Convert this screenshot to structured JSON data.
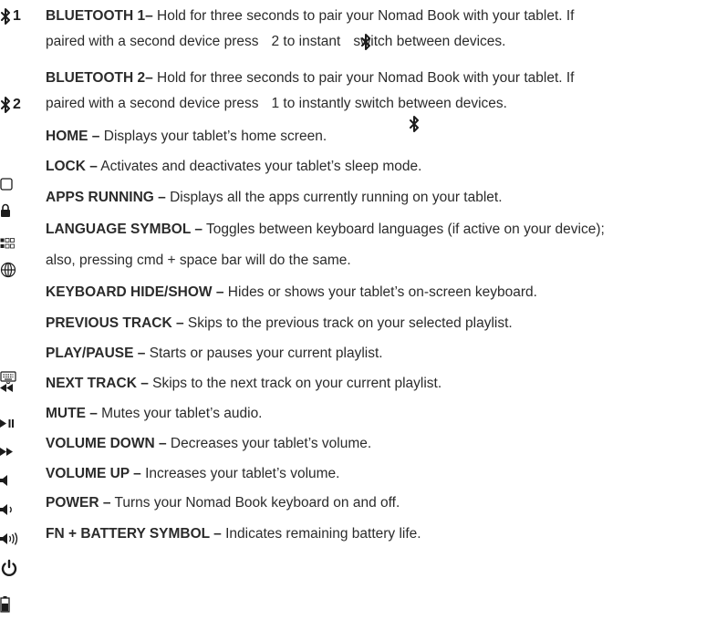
{
  "entries": [
    {
      "key": "BLUETOOTH 1–",
      "text": " Hold for three seconds to pair your Nomad Book with your tablet. If"
    },
    {
      "key": "",
      "text": "paired with a second device press"
    },
    {
      "key": "",
      "text": "2 to instant"
    },
    {
      "key": "",
      "text": "switch between devices."
    },
    {
      "key": "BLUETOOTH 2–",
      "text": " Hold for three seconds to pair your Nomad Book with your tablet. If"
    },
    {
      "key": "",
      "text": "paired with a second device press"
    },
    {
      "key": "",
      "text": "1 to instantly switch between devices."
    },
    {
      "key": "HOME –",
      "text": " Displays your tablet’s home screen."
    },
    {
      "key": "LOCK –",
      "text": " Activates and deactivates your tablet’s sleep mode."
    },
    {
      "key": "APPS RUNNING  –",
      "text": " Displays all the apps currently running on your tablet."
    },
    {
      "key": "LANGUAGE SYMBOL –",
      "text": "  Toggles between keyboard languages (if active on your device);"
    },
    {
      "key": "",
      "text": "also, pressing cmd + space bar will do the same."
    },
    {
      "key": "KEYBOARD HIDE/SHOW –",
      "text": " Hides or shows your tablet’s on-screen keyboard."
    },
    {
      "key": "PREVIOUS TRACK –",
      "text": " Skips to the previous track on your selected playlist."
    },
    {
      "key": "PLAY/PAUSE –",
      "text": " Starts or pauses your current playlist."
    },
    {
      "key": "NEXT TRACK –",
      "text": " Skips to the next track on your current playlist."
    },
    {
      "key": "MUTE –",
      "text": " Mutes your tablet’s audio."
    },
    {
      "key": "VOLUME DOWN –",
      "text": " Decreases your tablet’s volume."
    },
    {
      "key": "VOLUME UP –",
      "text": " Increases your tablet’s volume."
    },
    {
      "key": "POWER –",
      "text": " Turns your Nomad Book keyboard on and off."
    },
    {
      "key": "FN + BATTERY SYMBOL –",
      "text": "  Indicates remaining battery life."
    }
  ],
  "icons": {
    "bluetooth1_label": "1",
    "bluetooth2_label": "2",
    "names": [
      "bluetooth-icon",
      "home-icon",
      "lock-icon",
      "apps-icon",
      "globe-icon",
      "keyboard-icon",
      "rewind-icon",
      "play-pause-icon",
      "fast-forward-icon",
      "mute-icon",
      "volume-down-icon",
      "volume-up-icon",
      "power-icon",
      "battery-icon"
    ]
  }
}
